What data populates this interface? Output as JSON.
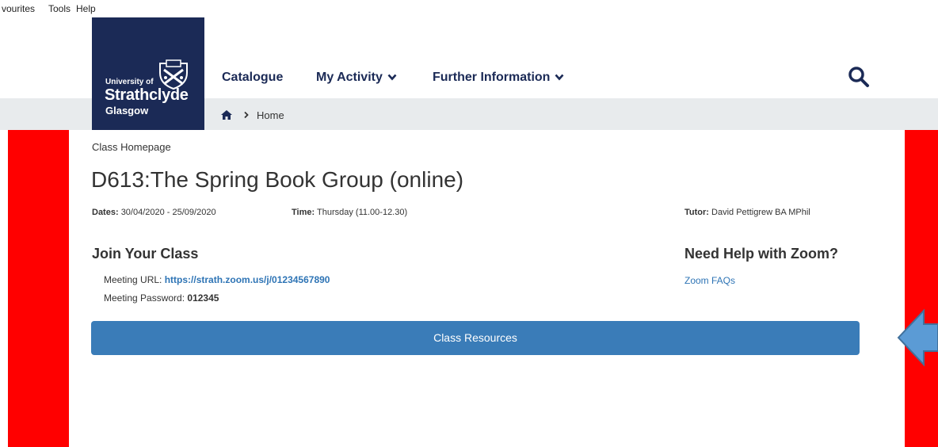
{
  "browser_menu": {
    "favourites": "vourites",
    "tools": "Tools",
    "help": "Help"
  },
  "logo": {
    "line1": "University of",
    "line2": "Strathclyde",
    "line3": "Glasgow"
  },
  "nav": {
    "catalogue": "Catalogue",
    "my_activity": "My Activity",
    "further_information": "Further Information"
  },
  "breadcrumb": {
    "home": "Home"
  },
  "page": {
    "section_label": "Class Homepage",
    "title": "D613:The Spring Book Group (online)",
    "dates_label": "Dates:",
    "dates_value": "30/04/2020 - 25/09/2020",
    "time_label": "Time:",
    "time_value": "Thursday (11.00-12.30)",
    "tutor_label": "Tutor:",
    "tutor_value": "David Pettigrew BA MPhil"
  },
  "join": {
    "heading": "Join Your Class",
    "url_label": "Meeting URL:",
    "url_value": "https://strath.zoom.us/j/01234567890",
    "password_label": "Meeting Password:",
    "password_value": "012345"
  },
  "zoom_help": {
    "heading": "Need Help with Zoom?",
    "faq_link": "Zoom FAQs"
  },
  "resources_button": "Class Resources",
  "colors": {
    "navy": "#1b2a56",
    "link_blue": "#2e74b5",
    "button_blue": "#3a7cb8",
    "red_bar": "#ff0000",
    "breadcrumb_bg": "#e8ebed",
    "arrow_blue": "#5b9bd5"
  },
  "icons": {
    "search": "search-icon",
    "home": "home-icon",
    "chevron": "chevron-down-icon",
    "crest": "crest-icon",
    "arrow": "arrow-left-icon"
  }
}
